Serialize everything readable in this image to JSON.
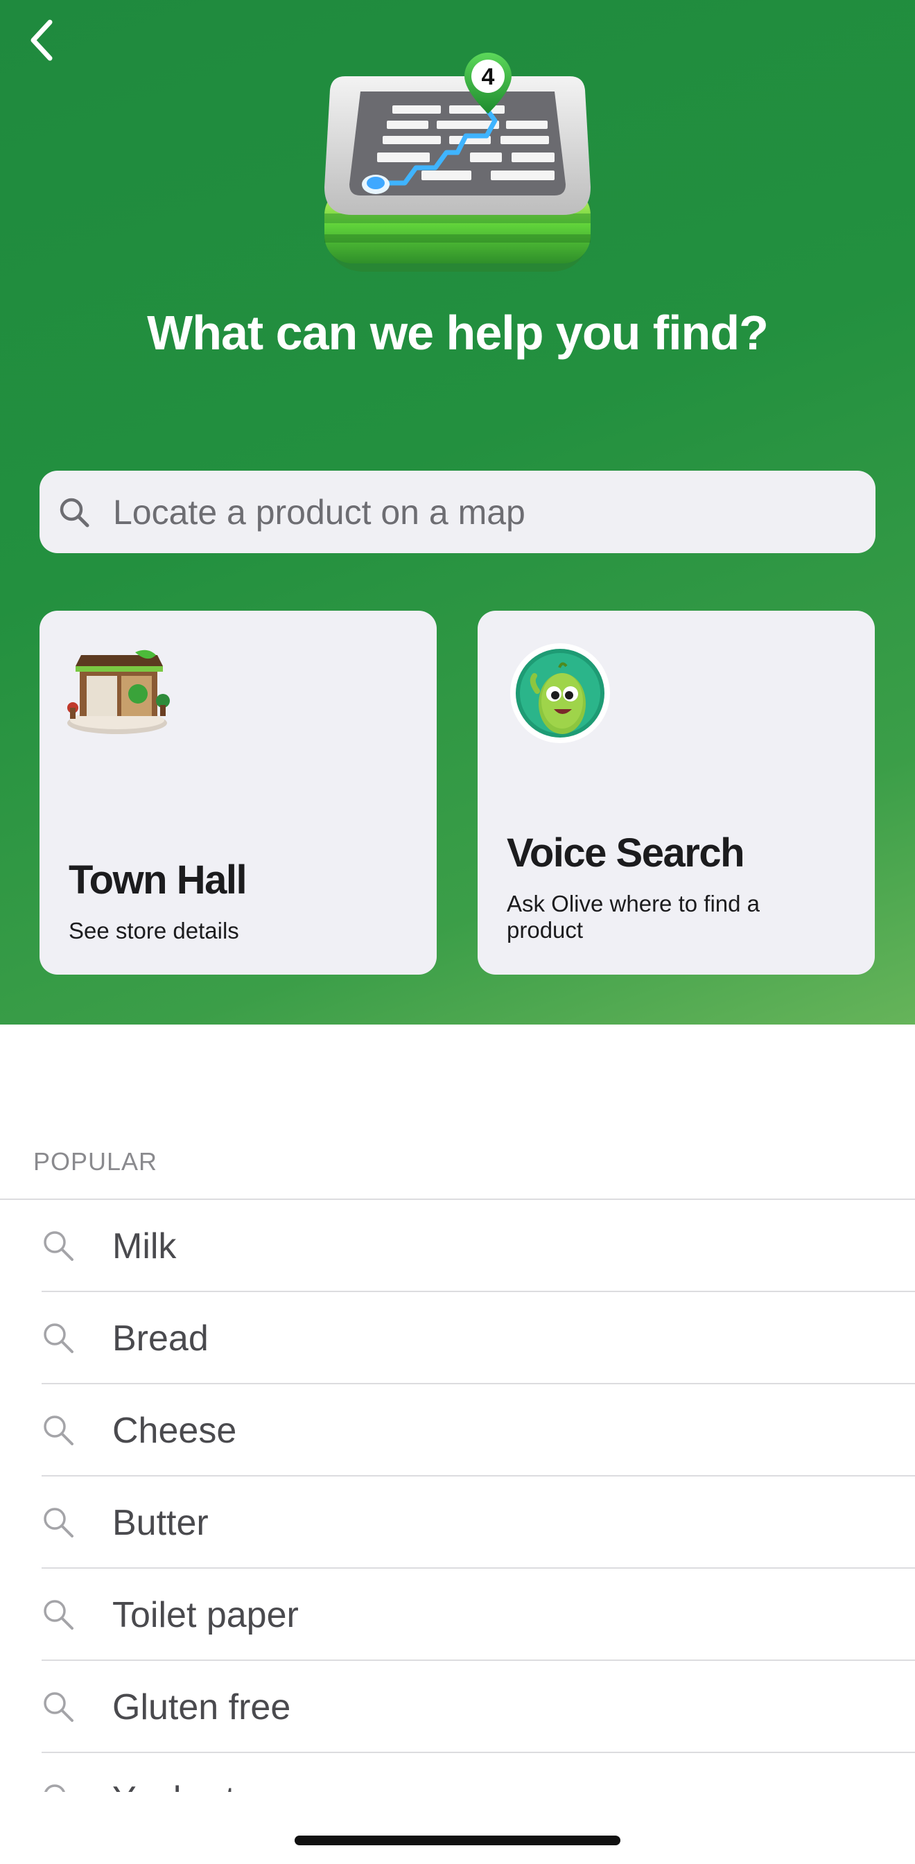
{
  "header": {
    "title": "What can we help you find?",
    "back_icon": "chevron-left-icon",
    "app_icon_badge": "4"
  },
  "search": {
    "placeholder": "Locate a product on a map",
    "value": ""
  },
  "cards": {
    "store": {
      "title": "Town Hall",
      "subtitle": "See store details",
      "icon": "store-illustration"
    },
    "voice": {
      "title": "Voice Search",
      "subtitle": "Ask Olive where to find a product",
      "icon": "olive-mascot"
    }
  },
  "popular": {
    "header": "POPULAR",
    "items": [
      {
        "label": "Milk"
      },
      {
        "label": "Bread"
      },
      {
        "label": "Cheese"
      },
      {
        "label": "Butter"
      },
      {
        "label": "Toilet paper"
      },
      {
        "label": "Gluten free"
      },
      {
        "label": "Yoghurt"
      }
    ]
  },
  "colors": {
    "brand_green": "#23903f",
    "card_bg": "#f0f0f5",
    "text_dark": "#1c1c1e",
    "text_muted": "#8a8a8e"
  }
}
